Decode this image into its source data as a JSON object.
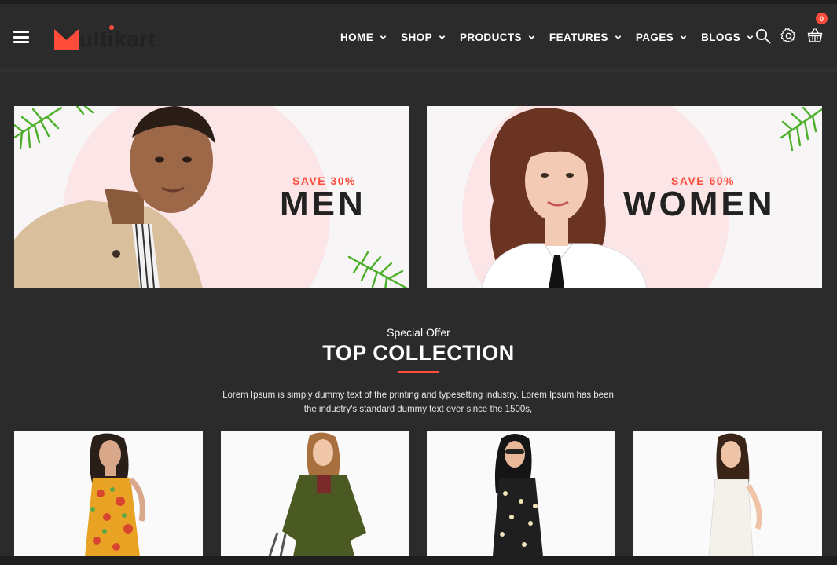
{
  "header": {
    "logo_text": "ultikart",
    "nav": [
      {
        "label": "HOME"
      },
      {
        "label": "SHOP"
      },
      {
        "label": "PRODUCTS"
      },
      {
        "label": "FEATURES"
      },
      {
        "label": "PAGES"
      },
      {
        "label": "BLOGS"
      }
    ],
    "cart_count": "0",
    "icons": [
      "menu-icon",
      "search-icon",
      "gear-icon",
      "basket-icon"
    ]
  },
  "banners": [
    {
      "save": "SAVE 30%",
      "title": "MEN"
    },
    {
      "save": "SAVE 60%",
      "title": "WOMEN"
    }
  ],
  "collection": {
    "subtitle": "Special Offer",
    "title": "TOP COLLECTION",
    "description": "Lorem Ipsum is simply dummy text of the printing and typesetting industry. Lorem Ipsum has been the industry's standard dummy text ever since the 1500s,"
  },
  "colors": {
    "accent": "#ff4c3b",
    "background": "#2b2b2b",
    "banner_bg": "#f7f5f6",
    "banner_circle": "#fbe5e6"
  }
}
